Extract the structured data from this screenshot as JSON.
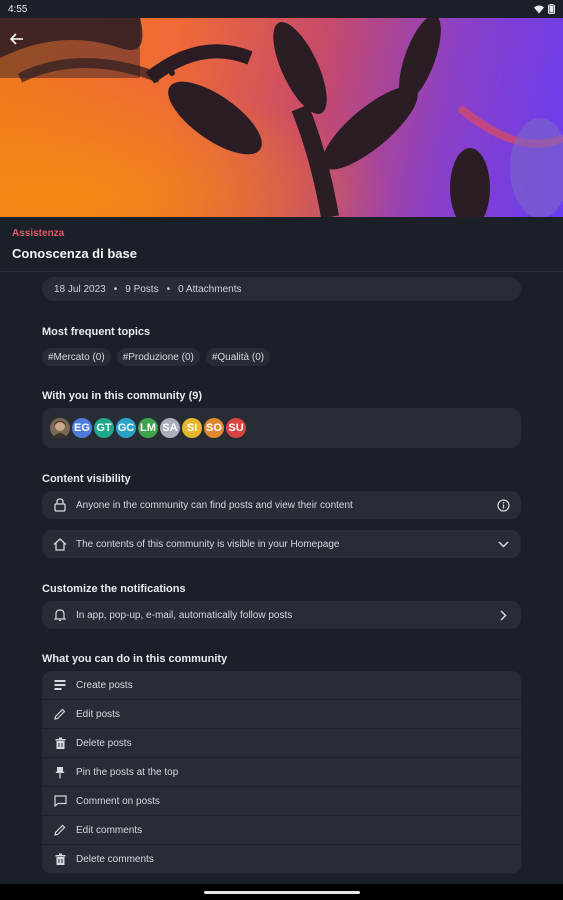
{
  "status_bar": {
    "time": "4:55"
  },
  "header": {
    "group_label": "Assistenza",
    "title": "Conoscenza di base"
  },
  "meta": {
    "date": "18 Jul 2023",
    "posts": "9 Posts",
    "attachments": "0 Attachments"
  },
  "topics": {
    "title": "Most frequent topics",
    "chips": [
      "#Mercato (0)",
      "#Produzione (0)",
      "#Qualità (0)"
    ]
  },
  "members": {
    "title": "With you in this community (9)",
    "avatars": [
      {
        "initials": "",
        "color": "#7a6a55",
        "photo": true
      },
      {
        "initials": "EG",
        "color": "#4f7be0"
      },
      {
        "initials": "GT",
        "color": "#1fa88a"
      },
      {
        "initials": "GC",
        "color": "#2aa3c9"
      },
      {
        "initials": "LM",
        "color": "#3fa34d"
      },
      {
        "initials": "SA",
        "color": "#a9aeb8"
      },
      {
        "initials": "SI",
        "color": "#e5b62e"
      },
      {
        "initials": "SO",
        "color": "#e0892f"
      },
      {
        "initials": "SU",
        "color": "#d8443f"
      }
    ]
  },
  "visibility": {
    "title": "Content visibility",
    "rows": [
      {
        "icon": "lock-icon",
        "text": "Anyone in the community can find posts and view their content",
        "trail": "info-icon"
      },
      {
        "icon": "home-icon",
        "text": "The contents of this community is visible in your Homepage",
        "trail": "chevron-down-icon"
      }
    ]
  },
  "notifications": {
    "title": "Customize the notifications",
    "text": "In app, pop-up, e-mail, automatically follow posts"
  },
  "permissions": {
    "title": "What you can do in this community",
    "items": [
      {
        "icon": "create-post-icon",
        "label": "Create posts"
      },
      {
        "icon": "pencil-icon",
        "label": "Edit posts"
      },
      {
        "icon": "trash-icon",
        "label": "Delete posts"
      },
      {
        "icon": "pin-icon",
        "label": "Pin the posts at the top"
      },
      {
        "icon": "comment-icon",
        "label": "Comment on posts"
      },
      {
        "icon": "pencil-icon",
        "label": "Edit comments"
      },
      {
        "icon": "trash-icon",
        "label": "Delete comments"
      }
    ]
  }
}
